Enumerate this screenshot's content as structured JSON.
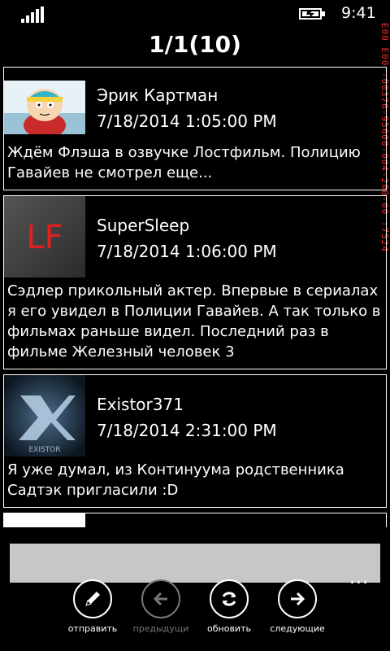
{
  "status_bar": {
    "time": "9:41",
    "signal_icon": "signal-bars-icon",
    "battery_icon": "battery-charging-icon"
  },
  "header": {
    "title": "1/1(10)"
  },
  "debug_overlay": "E00 E00 -00376-95600-004-200-00 :7524",
  "comments": [
    {
      "author": "Эрик Картман",
      "date": "7/18/2014 1:05:00 PM",
      "text": "Ждём Флэша в озвучке Лостфильм. Полицию Гавайев не смотрел еще..."
    },
    {
      "author": "SuperSleep",
      "date": "7/18/2014 1:06:00 PM",
      "text": "Сэдлер прикольный актер. Впервые в сериалах я его увидел в Полиции Гавайев. А так только в фильмах раньше видел. Последний раз в фильме Железный человек 3",
      "avatar_text": "LF"
    },
    {
      "author": "Existor371",
      "date": "7/18/2014 2:31:00 PM",
      "text": "Я уже думал, из Континуума родственника Садтэк пригласили :D",
      "avatar_text": "EXISTOR"
    }
  ],
  "input": {
    "value": "",
    "placeholder": ""
  },
  "app_bar": {
    "more": "...",
    "buttons": [
      {
        "label": "отправить",
        "icon": "pencil-icon",
        "enabled": true
      },
      {
        "label": "предыдущи",
        "icon": "arrow-left-icon",
        "enabled": false
      },
      {
        "label": "обновить",
        "icon": "refresh-icon",
        "enabled": true
      },
      {
        "label": "следующие",
        "icon": "arrow-right-icon",
        "enabled": true
      }
    ]
  }
}
